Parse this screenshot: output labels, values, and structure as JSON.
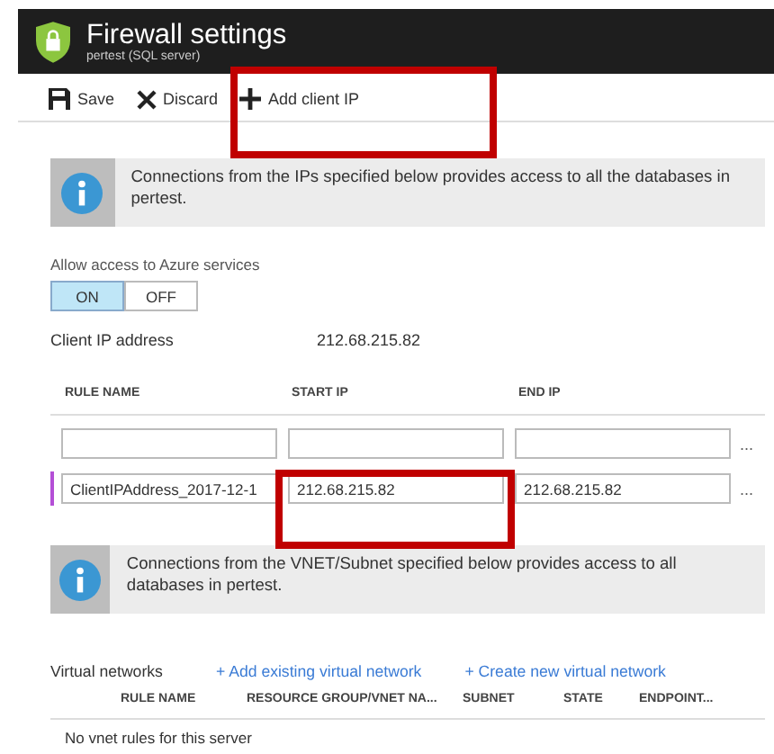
{
  "header": {
    "title": "Firewall settings",
    "subtitle": "pertest (SQL server)"
  },
  "toolbar": [
    {
      "kind": "save",
      "label": "Save"
    },
    {
      "kind": "discard",
      "label": "Discard"
    },
    {
      "kind": "add",
      "label": "Add client IP"
    }
  ],
  "info_1": "Connections from the IPs specified below provides access to all the databases in pertest.",
  "azure_access": {
    "label": "Allow access to Azure services",
    "options": [
      {
        "label": "ON",
        "selected": true
      },
      {
        "label": "OFF",
        "selected": false
      }
    ]
  },
  "client_ip": {
    "label": "Client IP address",
    "value": "212.68.215.82"
  },
  "rules_table": {
    "columns": [
      "RULE NAME",
      "START IP",
      "END IP"
    ],
    "rows": [
      {
        "highlighted": false,
        "more": "..."
      },
      {
        "highlighted": true,
        "rule_name": "ClientIPAddress_2017-12-1",
        "start_ip": "212.68.215.82",
        "end_ip": "212.68.215.82",
        "more": "..."
      }
    ]
  },
  "info_2": "Connections from the VNET/Subnet specified below provides access to all databases in pertest.",
  "virtual_networks": {
    "label": "Virtual networks",
    "links": [
      "+ Add existing virtual network",
      "+ Create new virtual network"
    ],
    "columns": [
      "RULE NAME",
      "RESOURCE GROUP/VNET NA...",
      "SUBNET",
      "STATE",
      "ENDPOINT..."
    ],
    "empty": "No vnet rules for this server"
  }
}
